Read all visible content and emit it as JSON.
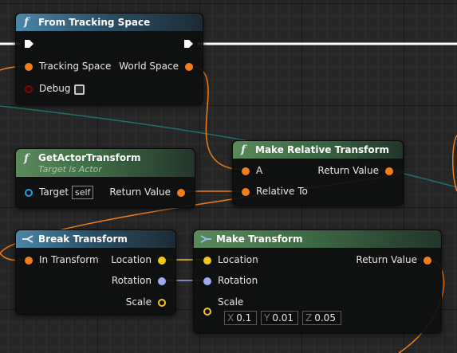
{
  "colors": {
    "transform_pin": "#f07e1b",
    "vector_pin": "#f5c518",
    "rotator_pin": "#a0aaf0",
    "bool_pin": "#8b0000",
    "object_pin": "#1fa0e6"
  },
  "nodes": {
    "from_tracking": {
      "title": "From Tracking Space",
      "icon": "function-icon",
      "pins": {
        "tracking_space": "Tracking Space",
        "world_space": "World Space",
        "debug": "Debug"
      }
    },
    "get_actor_transform": {
      "title": "GetActorTransform",
      "subtitle": "Target is Actor",
      "icon": "function-icon",
      "pins": {
        "target": "Target",
        "target_default": "self",
        "return_value": "Return Value"
      }
    },
    "make_relative": {
      "title": "Make Relative Transform",
      "icon": "function-icon",
      "pins": {
        "a": "A",
        "relative_to": "Relative To",
        "return_value": "Return Value"
      }
    },
    "break_transform": {
      "title": "Break Transform",
      "icon": "break-struct-icon",
      "pins": {
        "in_transform": "In Transform",
        "location": "Location",
        "rotation": "Rotation",
        "scale": "Scale"
      }
    },
    "make_transform": {
      "title": "Make Transform",
      "icon": "make-struct-icon",
      "pins": {
        "location": "Location",
        "rotation": "Rotation",
        "scale": "Scale",
        "return_value": "Return Value"
      },
      "scale_value": {
        "x_label": "X",
        "x": "0.1",
        "y_label": "Y",
        "y": "0.01",
        "z_label": "Z",
        "z": "0.05"
      }
    }
  }
}
